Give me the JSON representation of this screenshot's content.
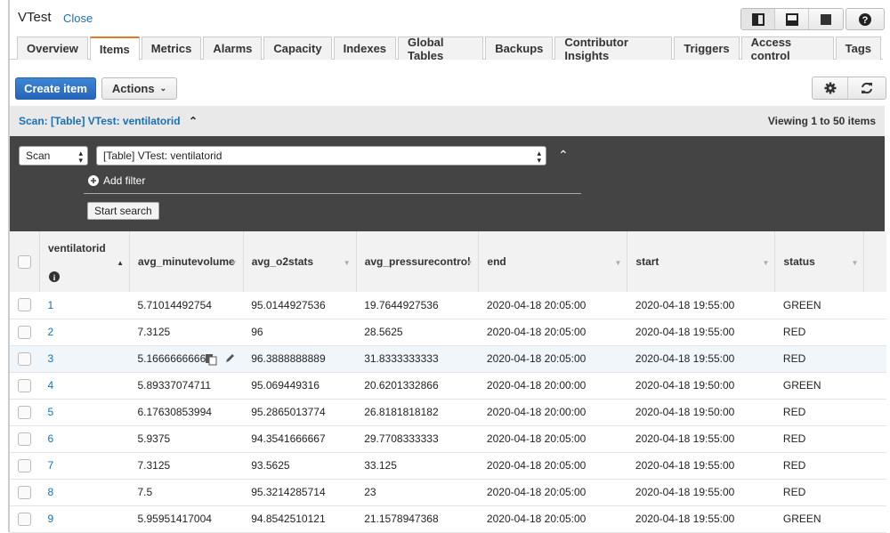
{
  "header": {
    "title": "VTest",
    "close": "Close"
  },
  "tabs": [
    "Overview",
    "Items",
    "Metrics",
    "Alarms",
    "Capacity",
    "Indexes",
    "Global Tables",
    "Backups",
    "Contributor Insights",
    "Triggers",
    "Access control",
    "Tags"
  ],
  "active_tab": "Items",
  "toolbar": {
    "create": "Create item",
    "actions": "Actions"
  },
  "scan": {
    "label": "Scan: [Table] VTest: ventilatorid",
    "viewing": "Viewing 1 to 50 items",
    "mode": "Scan",
    "target": "[Table] VTest: ventilatorid",
    "add_filter": "Add filter",
    "start": "Start search"
  },
  "columns": [
    "ventilatorid",
    "avg_minutevolume",
    "avg_o2stats",
    "avg_pressurecontrol",
    "end",
    "start",
    "status"
  ],
  "rows": [
    [
      "1",
      "5.71014492754",
      "95.0144927536",
      "19.7644927536",
      "2020-04-18 20:05:00",
      "2020-04-18 19:55:00",
      "GREEN"
    ],
    [
      "2",
      "7.3125",
      "96",
      "28.5625",
      "2020-04-18 20:05:00",
      "2020-04-18 19:55:00",
      "RED"
    ],
    [
      "3",
      "5.16666666667",
      "96.3888888889",
      "31.8333333333",
      "2020-04-18 20:05:00",
      "2020-04-18 19:55:00",
      "RED"
    ],
    [
      "4",
      "5.89337074711",
      "95.069449316",
      "20.6201332866",
      "2020-04-18 20:00:00",
      "2020-04-18 19:50:00",
      "GREEN"
    ],
    [
      "5",
      "6.17630853994",
      "95.2865013774",
      "26.8181818182",
      "2020-04-18 20:00:00",
      "2020-04-18 19:50:00",
      "RED"
    ],
    [
      "6",
      "5.9375",
      "94.3541666667",
      "29.7708333333",
      "2020-04-18 20:05:00",
      "2020-04-18 19:55:00",
      "RED"
    ],
    [
      "7",
      "7.3125",
      "93.5625",
      "33.125",
      "2020-04-18 20:05:00",
      "2020-04-18 19:55:00",
      "RED"
    ],
    [
      "8",
      "7.5",
      "95.3214285714",
      "23",
      "2020-04-18 20:05:00",
      "2020-04-18 19:55:00",
      "RED"
    ],
    [
      "9",
      "5.95951417004",
      "94.8542510121",
      "21.1578947368",
      "2020-04-18 20:05:00",
      "2020-04-18 19:55:00",
      "GREEN"
    ]
  ],
  "hover_row": 3,
  "colors": {
    "accent": "#1a6fb5",
    "primary": "#2f73c6",
    "active_tab": "#e07a27",
    "panel": "#444444"
  }
}
